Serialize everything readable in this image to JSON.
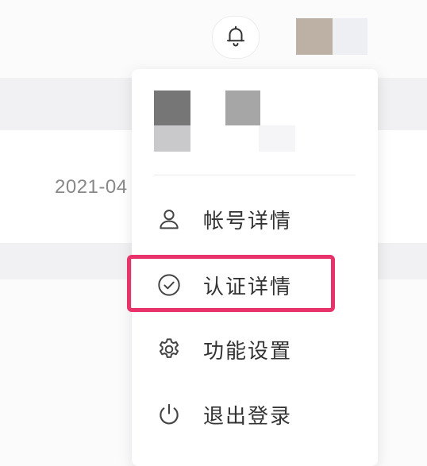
{
  "background": {
    "date_text": "2021-04"
  },
  "header": {
    "bell_icon": "bell-icon",
    "avatar": "avatar"
  },
  "menu": {
    "items": [
      {
        "icon": "user-icon",
        "label": "帐号详情"
      },
      {
        "icon": "check-circle-icon",
        "label": "认证详情",
        "highlighted": true
      },
      {
        "icon": "gear-icon",
        "label": "功能设置"
      },
      {
        "icon": "power-icon",
        "label": "退出登录"
      }
    ]
  },
  "colors": {
    "highlight": "#e8336a",
    "text": "#333333",
    "icon": "#444444"
  }
}
